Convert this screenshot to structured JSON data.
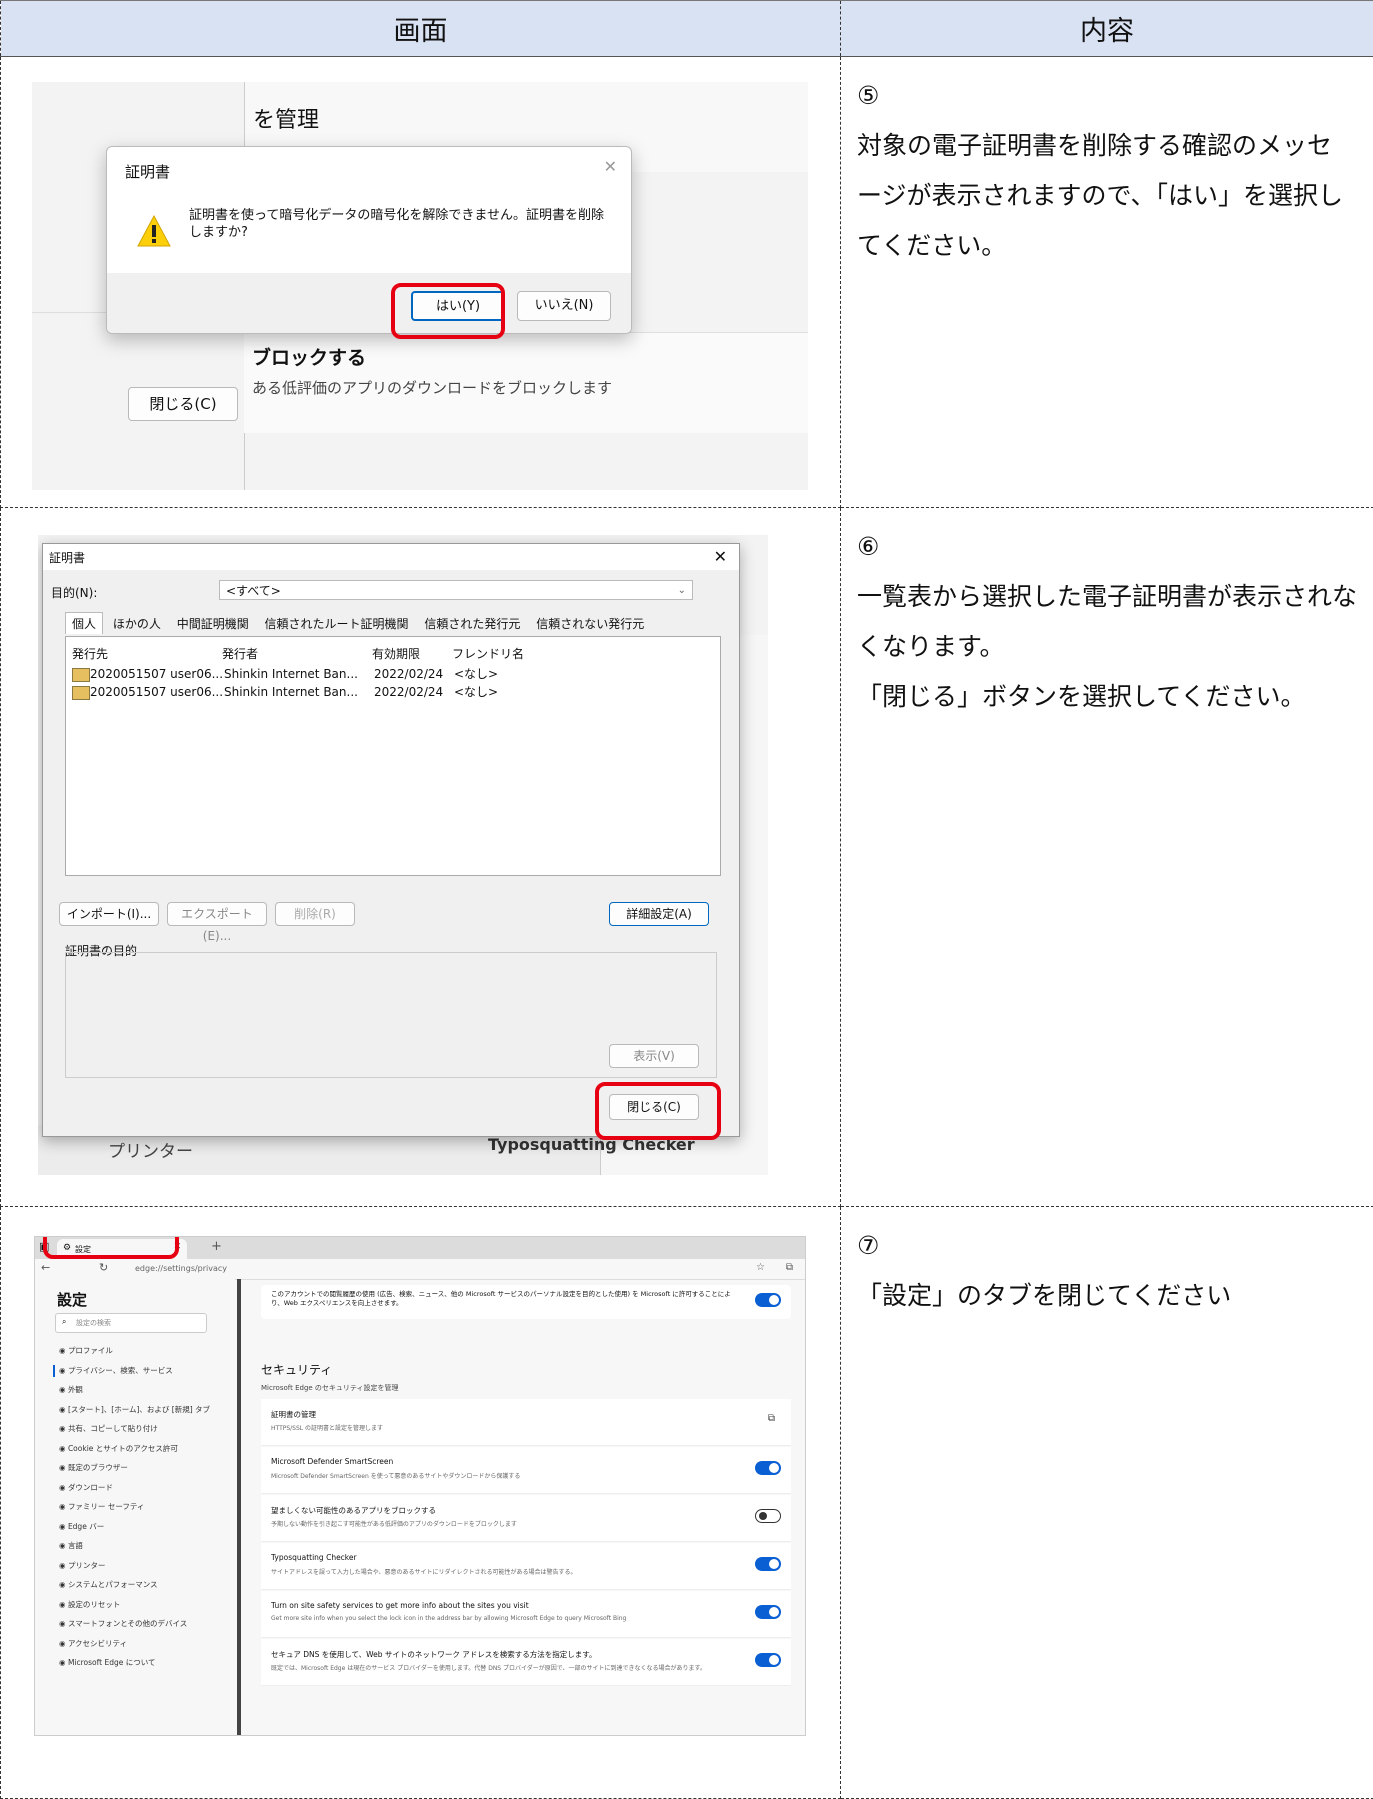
{
  "header": {
    "col1": "画面",
    "col2": "内容"
  },
  "steps": [
    {
      "num": "⑤",
      "text": "対象の電子証明書を削除する確認のメッセージが表示されますので、「はい」を選択してください。"
    },
    {
      "num": "⑥",
      "text": "一覧表から選択した電子証明書が表示されなくなります。",
      "text2": "「閉じる」ボタンを選択してください。"
    },
    {
      "num": "⑦",
      "text": "「設定」のタブを閉じてください"
    }
  ],
  "shot1": {
    "bg_heading": "を管理",
    "dialog_title": "証明書",
    "message": "証明書を使って暗号化データの暗号化を解除できません。証明書を削除しますか?",
    "yes_button": "はい(Y)",
    "no_button": "いいえ(N)",
    "bg_block_title": "ブロックする",
    "bg_block_desc": "ある低評価のアプリのダウンロードをブロックします",
    "close_button": "閉じる(C)"
  },
  "shot2": {
    "title": "証明書",
    "purpose_label": "目的(N):",
    "purpose_value": "<すべて>",
    "tabs": [
      "個人",
      "ほかの人",
      "中間証明機関",
      "信頼されたルート証明機関",
      "信頼された発行元",
      "信頼されない発行元"
    ],
    "columns": [
      "発行先",
      "発行者",
      "有効期限",
      "フレンドリ名"
    ],
    "rows": [
      [
        "2020051507 user06...",
        "Shinkin Internet Ban...",
        "2022/02/24",
        "<なし>"
      ],
      [
        "2020051507 user06...",
        "Shinkin Internet Ban...",
        "2022/02/24",
        "<なし>"
      ]
    ],
    "import_button": "インポート(I)...",
    "export_button": "エクスポート(E)...",
    "delete_button": "削除(R)",
    "advanced_button": "詳細設定(A)",
    "purpose_group": "証明書の目的",
    "view_button": "表示(V)",
    "close_button": "閉じる(C)",
    "bg_printer": "プリンター",
    "bg_typo": "Typosquatting Checker"
  },
  "shot3": {
    "tab_label": "設定",
    "url": "edge://settings/privacy",
    "sidebar_title": "設定",
    "search_placeholder": "設定の検索",
    "sidebar_items": [
      "プロファイル",
      "プライバシー、検索、サービス",
      "外観",
      "[スタート]、[ホーム]、および [新規] タブ",
      "共有、コピーして貼り付け",
      "Cookie とサイトのアクセス許可",
      "既定のブラウザー",
      "ダウンロード",
      "ファミリー セーフティ",
      "Edge バー",
      "言語",
      "プリンター",
      "システムとパフォーマンス",
      "設定のリセット",
      "スマートフォンとその他のデバイス",
      "アクセシビリティ",
      "Microsoft Edge について"
    ],
    "top_text": "このアカウントでの閲覧履歴の使用 (広告、検索、ニュース、他の Microsoft サービスのパーソナル設定を目的とした使用) を Microsoft に許可することにより、Web エクスペリエンスを向上させます。",
    "security_title": "セキュリティ",
    "security_desc": "Microsoft Edge のセキュリティ設定を管理",
    "settings": [
      {
        "title": "証明書の管理",
        "desc": "HTTPS/SSL の証明書と設定を管理します",
        "control": "link"
      },
      {
        "title": "Microsoft Defender SmartScreen",
        "desc": "Microsoft Defender SmartScreen を使って悪意のあるサイトやダウンロードから保護する",
        "control": "on"
      },
      {
        "title": "望ましくない可能性のあるアプリをブロックする",
        "desc": "予期しない動作を引き起こす可能性がある低評価のアプリのダウンロードをブロックします",
        "control": "off"
      },
      {
        "title": "Typosquatting Checker",
        "desc": "サイトアドレスを誤って入力した場合や、悪意のあるサイトにリダイレクトされる可能性がある場合は警告する。",
        "control": "on"
      },
      {
        "title": "Turn on site safety services to get more info about the sites you visit",
        "desc": "Get more site info when you select the lock icon in the address bar by allowing Microsoft Edge to query Microsoft Bing",
        "control": "on"
      },
      {
        "title": "セキュア DNS を使用して、Web サイトのネットワーク アドレスを検索する方法を指定します。",
        "desc": "既定では、Microsoft Edge は現在のサービス プロバイダーを使用します。代替 DNS プロバイダーが原因で、一部のサイトに到達できなくなる場合があります。",
        "control": "on"
      }
    ]
  }
}
